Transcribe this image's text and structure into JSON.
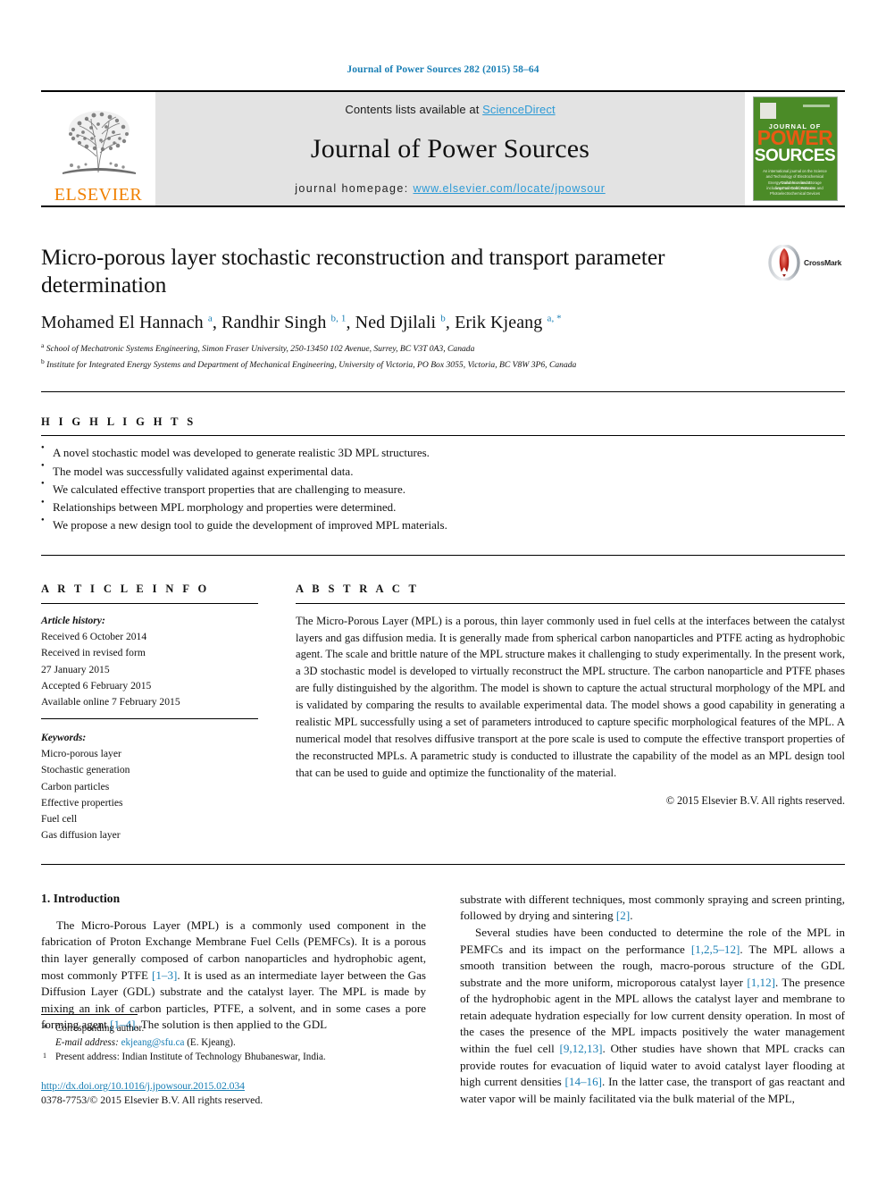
{
  "running_head": "Journal of Power Sources 282 (2015) 58–64",
  "masthead": {
    "publisher_logo_text": "ELSEVIER",
    "contents_prefix": "Contents lists available at ",
    "contents_link": "ScienceDirect",
    "journal_name": "Journal of Power Sources",
    "homepage_prefix": "journal homepage: ",
    "homepage_link": "www.elsevier.com/locate/jpowsour",
    "cover": {
      "top_label": "JOURNAL OF",
      "title_top": "POWER",
      "title_bottom": "SOURCES",
      "blurb": "An international journal on the Science and Technology of Electrochemical Energy Conversion and Storage including Fuel Cells, Batteries and Photoelectrochemical Devices",
      "footer": "Available online at\nwww.sciencedirect.com"
    }
  },
  "article": {
    "title": "Micro-porous layer stochastic reconstruction and transport parameter determination",
    "crossmark_label": "CrossMark",
    "authors_html": "Mohamed El Hannach <sup>a</sup>, Randhir Singh <sup>b, 1</sup>, Ned Djilali <sup>b</sup>, Erik Kjeang <sup>a, *</sup>",
    "affiliations": [
      {
        "marker": "a",
        "text": "School of Mechatronic Systems Engineering, Simon Fraser University, 250-13450 102 Avenue, Surrey, BC V3T 0A3, Canada"
      },
      {
        "marker": "b",
        "text": "Institute for Integrated Energy Systems and Department of Mechanical Engineering, University of Victoria, PO Box 3055, Victoria, BC V8W 3P6, Canada"
      }
    ]
  },
  "highlights": {
    "heading": "H I G H L I G H T S",
    "items": [
      "A novel stochastic model was developed to generate realistic 3D MPL structures.",
      "The model was successfully validated against experimental data.",
      "We calculated effective transport properties that are challenging to measure.",
      "Relationships between MPL morphology and properties were determined.",
      "We propose a new design tool to guide the development of improved MPL materials."
    ]
  },
  "article_info": {
    "heading": "A R T I C L E   I N F O",
    "history_label": "Article history:",
    "history": [
      "Received 6 October 2014",
      "Received in revised form",
      "27 January 2015",
      "Accepted 6 February 2015",
      "Available online 7 February 2015"
    ],
    "keywords_label": "Keywords:",
    "keywords": [
      "Micro-porous layer",
      "Stochastic generation",
      "Carbon particles",
      "Effective properties",
      "Fuel cell",
      "Gas diffusion layer"
    ]
  },
  "abstract": {
    "heading": "A B S T R A C T",
    "text": "The Micro-Porous Layer (MPL) is a porous, thin layer commonly used in fuel cells at the interfaces between the catalyst layers and gas diffusion media. It is generally made from spherical carbon nanoparticles and PTFE acting as hydrophobic agent. The scale and brittle nature of the MPL structure makes it challenging to study experimentally. In the present work, a 3D stochastic model is developed to virtually reconstruct the MPL structure. The carbon nanoparticle and PTFE phases are fully distinguished by the algorithm. The model is shown to capture the actual structural morphology of the MPL and is validated by comparing the results to available experimental data. The model shows a good capability in generating a realistic MPL successfully using a set of parameters introduced to capture specific morphological features of the MPL. A numerical model that resolves diffusive transport at the pore scale is used to compute the effective transport properties of the reconstructed MPLs. A parametric study is conducted to illustrate the capability of the model as an MPL design tool that can be used to guide and optimize the functionality of the material.",
    "copyright": "© 2015 Elsevier B.V. All rights reserved."
  },
  "body": {
    "section_number_title": "1. Introduction",
    "left_paragraph_html": "The Micro-Porous Layer (MPL) is a commonly used component in the fabrication of Proton Exchange Membrane Fuel Cells (PEMFCs). It is a porous thin layer generally composed of carbon nanoparticles and hydrophobic agent, most commonly PTFE <span class=\"ref\">[1–3]</span>. It is used as an intermediate layer between the Gas Diffusion Layer (GDL) substrate and the catalyst layer. The MPL is made by mixing an ink of carbon particles, PTFE, a solvent, and in some cases a pore forming agent <span class=\"ref\">[1–4]</span>. The solution is then applied to the GDL",
    "right_paragraph_1_html": "substrate with different techniques, most commonly spraying and screen printing, followed by drying and sintering <span class=\"ref\">[2]</span>.",
    "right_paragraph_2_html": "Several studies have been conducted to determine the role of the MPL in PEMFCs and its impact on the performance <span class=\"ref\">[1,2,5–12]</span>. The MPL allows a smooth transition between the rough, macro-porous structure of the GDL substrate and the more uniform, microporous catalyst layer <span class=\"ref\">[1,12]</span>. The presence of the hydrophobic agent in the MPL allows the catalyst layer and membrane to retain adequate hydration especially for low current density operation. In most of the cases the presence of the MPL impacts positively the water management within the fuel cell <span class=\"ref\">[9,12,13]</span>. Other studies have shown that MPL cracks can provide routes for evacuation of liquid water to avoid catalyst layer flooding at high current densities <span class=\"ref\">[14–16]</span>. In the latter case, the transport of gas reactant and water vapor will be mainly facilitated via the bulk material of the MPL,"
  },
  "footnotes": {
    "corresponding_marker": "*",
    "corresponding_text": "Corresponding author.",
    "email_label": "E-mail address:",
    "email_link": "ekjeang@sfu.ca",
    "email_suffix": " (E. Kjeang).",
    "present_marker": "1",
    "present_text": "Present address: Indian Institute of Technology Bhubaneswar, India.",
    "doi": "http://dx.doi.org/10.1016/j.jpowsour.2015.02.034",
    "issn_line": "0378-7753/© 2015 Elsevier B.V. All rights reserved."
  },
  "colors": {
    "link_blue": "#1a7fb5",
    "sciencedirect_blue": "#2e9bd6",
    "elsevier_orange": "#F08000",
    "cover_green": "#4b8b27",
    "cover_orange": "#ea5a13"
  }
}
